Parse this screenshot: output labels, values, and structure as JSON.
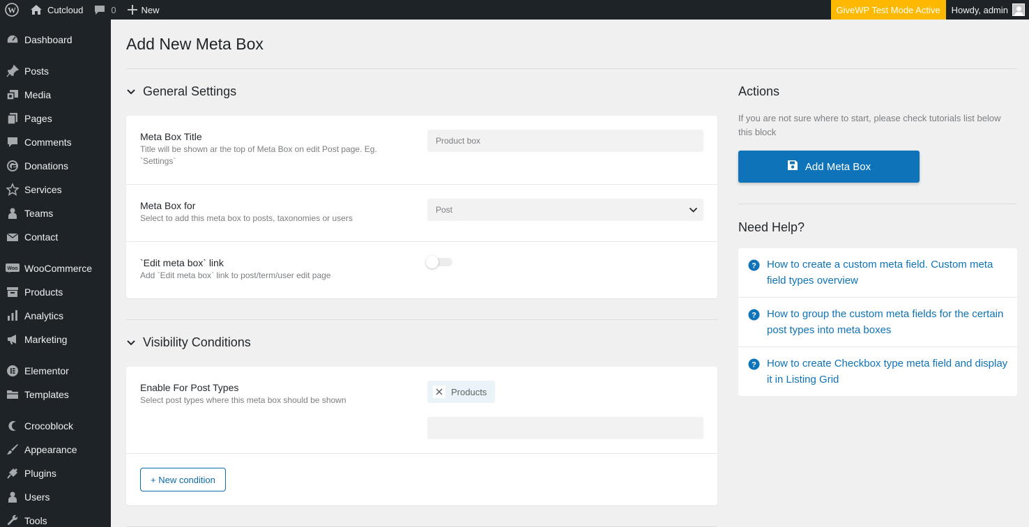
{
  "adminbar": {
    "site_name": "Cutcloud",
    "comments_count": "0",
    "new_label": "New",
    "givewp_label": "GiveWP Test Mode Active",
    "howdy_label": "Howdy, admin"
  },
  "sidebar": {
    "items": [
      {
        "label": "Dashboard",
        "icon": "dashboard-icon"
      },
      {
        "label": "Posts",
        "icon": "pin-icon"
      },
      {
        "label": "Media",
        "icon": "media-icon"
      },
      {
        "label": "Pages",
        "icon": "pages-icon"
      },
      {
        "label": "Comments",
        "icon": "comment-icon"
      },
      {
        "label": "Donations",
        "icon": "givewp-icon"
      },
      {
        "label": "Services",
        "icon": "star-icon"
      },
      {
        "label": "Teams",
        "icon": "person-icon"
      },
      {
        "label": "Contact",
        "icon": "mail-icon"
      },
      {
        "label": "WooCommerce",
        "icon": "woo-icon"
      },
      {
        "label": "Products",
        "icon": "archive-icon"
      },
      {
        "label": "Analytics",
        "icon": "bar-chart-icon"
      },
      {
        "label": "Marketing",
        "icon": "megaphone-icon"
      },
      {
        "label": "Elementor",
        "icon": "elementor-icon"
      },
      {
        "label": "Templates",
        "icon": "folder-icon"
      },
      {
        "label": "Crocoblock",
        "icon": "crocoblock-icon"
      },
      {
        "label": "Appearance",
        "icon": "brush-icon"
      },
      {
        "label": "Plugins",
        "icon": "plug-icon"
      },
      {
        "label": "Users",
        "icon": "users-icon"
      },
      {
        "label": "Tools",
        "icon": "wrench-icon"
      }
    ]
  },
  "page": {
    "title": "Add New Meta Box"
  },
  "general": {
    "heading": "General Settings",
    "title_label": "Meta Box Title",
    "title_desc": "Title will be shown ar the top of Meta Box on edit Post page. Eg. `Settings`",
    "title_placeholder": "Product box",
    "for_label": "Meta Box for",
    "for_desc": "Select to add this meta box to posts, taxonomies or users",
    "for_value": "Post",
    "link_label": "`Edit meta box` link",
    "link_desc": "Add `Edit meta box` link to post/term/user edit page",
    "link_enabled": false
  },
  "visibility": {
    "heading": "Visibility Conditions",
    "post_types_label": "Enable For Post Types",
    "post_types_desc": "Select post types where this meta box should be shown",
    "selected_tags": [
      "Products"
    ],
    "new_condition_label": "+ New condition"
  },
  "actions": {
    "heading": "Actions",
    "note": "If you are not sure where to start, please check tutorials list below this block",
    "add_button_label": "Add Meta Box"
  },
  "help": {
    "heading": "Need Help?",
    "links": [
      "How to create a custom meta field. Custom meta field types overview",
      "How to group the custom meta fields for the certain post types into meta boxes",
      "How to create Checkbox type meta field and display it in Listing Grid"
    ]
  },
  "colors": {
    "accent": "#0e73b8",
    "admin_bar": "#1d2327",
    "givewp_badge": "#fcb900"
  }
}
